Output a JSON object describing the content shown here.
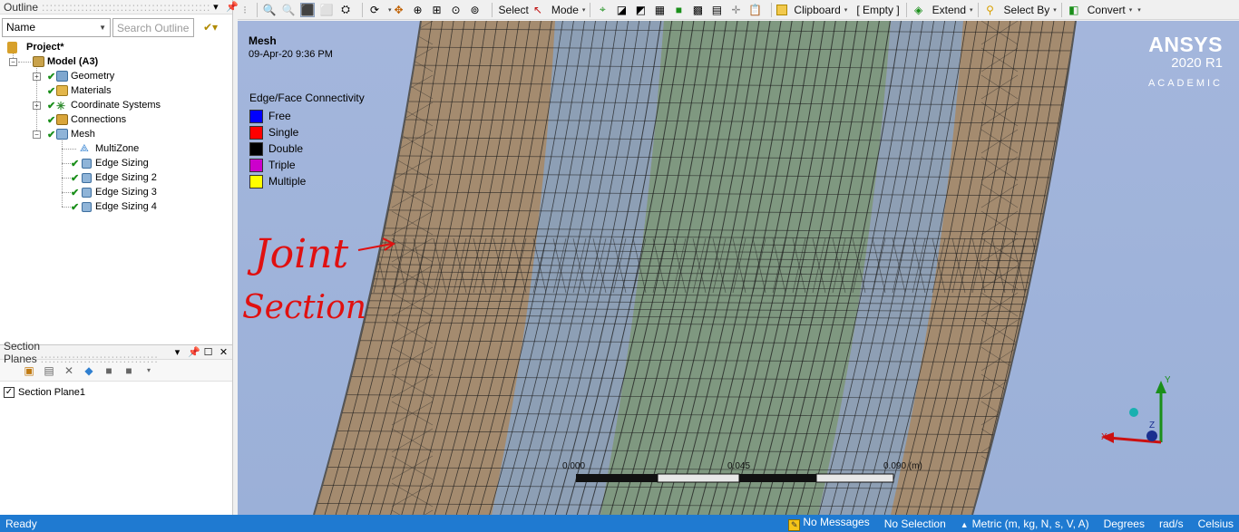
{
  "outline": {
    "title": "Outline",
    "filter_select": "Name",
    "search_placeholder": "Search Outline",
    "tree": {
      "project": "Project*",
      "model": "Model (A3)",
      "geometry": "Geometry",
      "materials": "Materials",
      "coordinate_systems": "Coordinate Systems",
      "connections": "Connections",
      "mesh": "Mesh",
      "mesh_children": [
        "MultiZone",
        "Edge Sizing",
        "Edge Sizing 2",
        "Edge Sizing 3",
        "Edge Sizing 4"
      ]
    }
  },
  "section_planes": {
    "title": "Section Planes",
    "items": [
      "Section Plane1"
    ]
  },
  "toolbar": {
    "select": "Select",
    "mode": "Mode",
    "clipboard": "Clipboard",
    "empty": "[ Empty ]",
    "extend": "Extend",
    "select_by": "Select By",
    "convert": "Convert"
  },
  "viewport": {
    "title": "Mesh",
    "date": "09-Apr-20 9:36 PM",
    "legend_title": "Edge/Face Connectivity",
    "legend": [
      {
        "label": "Free",
        "color": "#0000ff"
      },
      {
        "label": "Single",
        "color": "#ff0000"
      },
      {
        "label": "Double",
        "color": "#000000"
      },
      {
        "label": "Triple",
        "color": "#cc00cc"
      },
      {
        "label": "Multiple",
        "color": "#ffff00"
      }
    ],
    "brand": {
      "name": "ANSYS",
      "version": "2020 R1",
      "edition": "ACADEMIC"
    },
    "annotation_line1": "Joint",
    "annotation_line2": "Section",
    "scale_labels": [
      "0.000",
      "0.045",
      "0.090 (m)"
    ],
    "triad": {
      "x": "X",
      "y": "Y",
      "z": "Z"
    }
  },
  "status": {
    "ready": "Ready",
    "messages": "No Messages",
    "selection": "No Selection",
    "units": "Metric (m, kg, N, s, V, A)",
    "angle": "Degrees",
    "rate": "rad/s",
    "temperature": "Celsius"
  }
}
